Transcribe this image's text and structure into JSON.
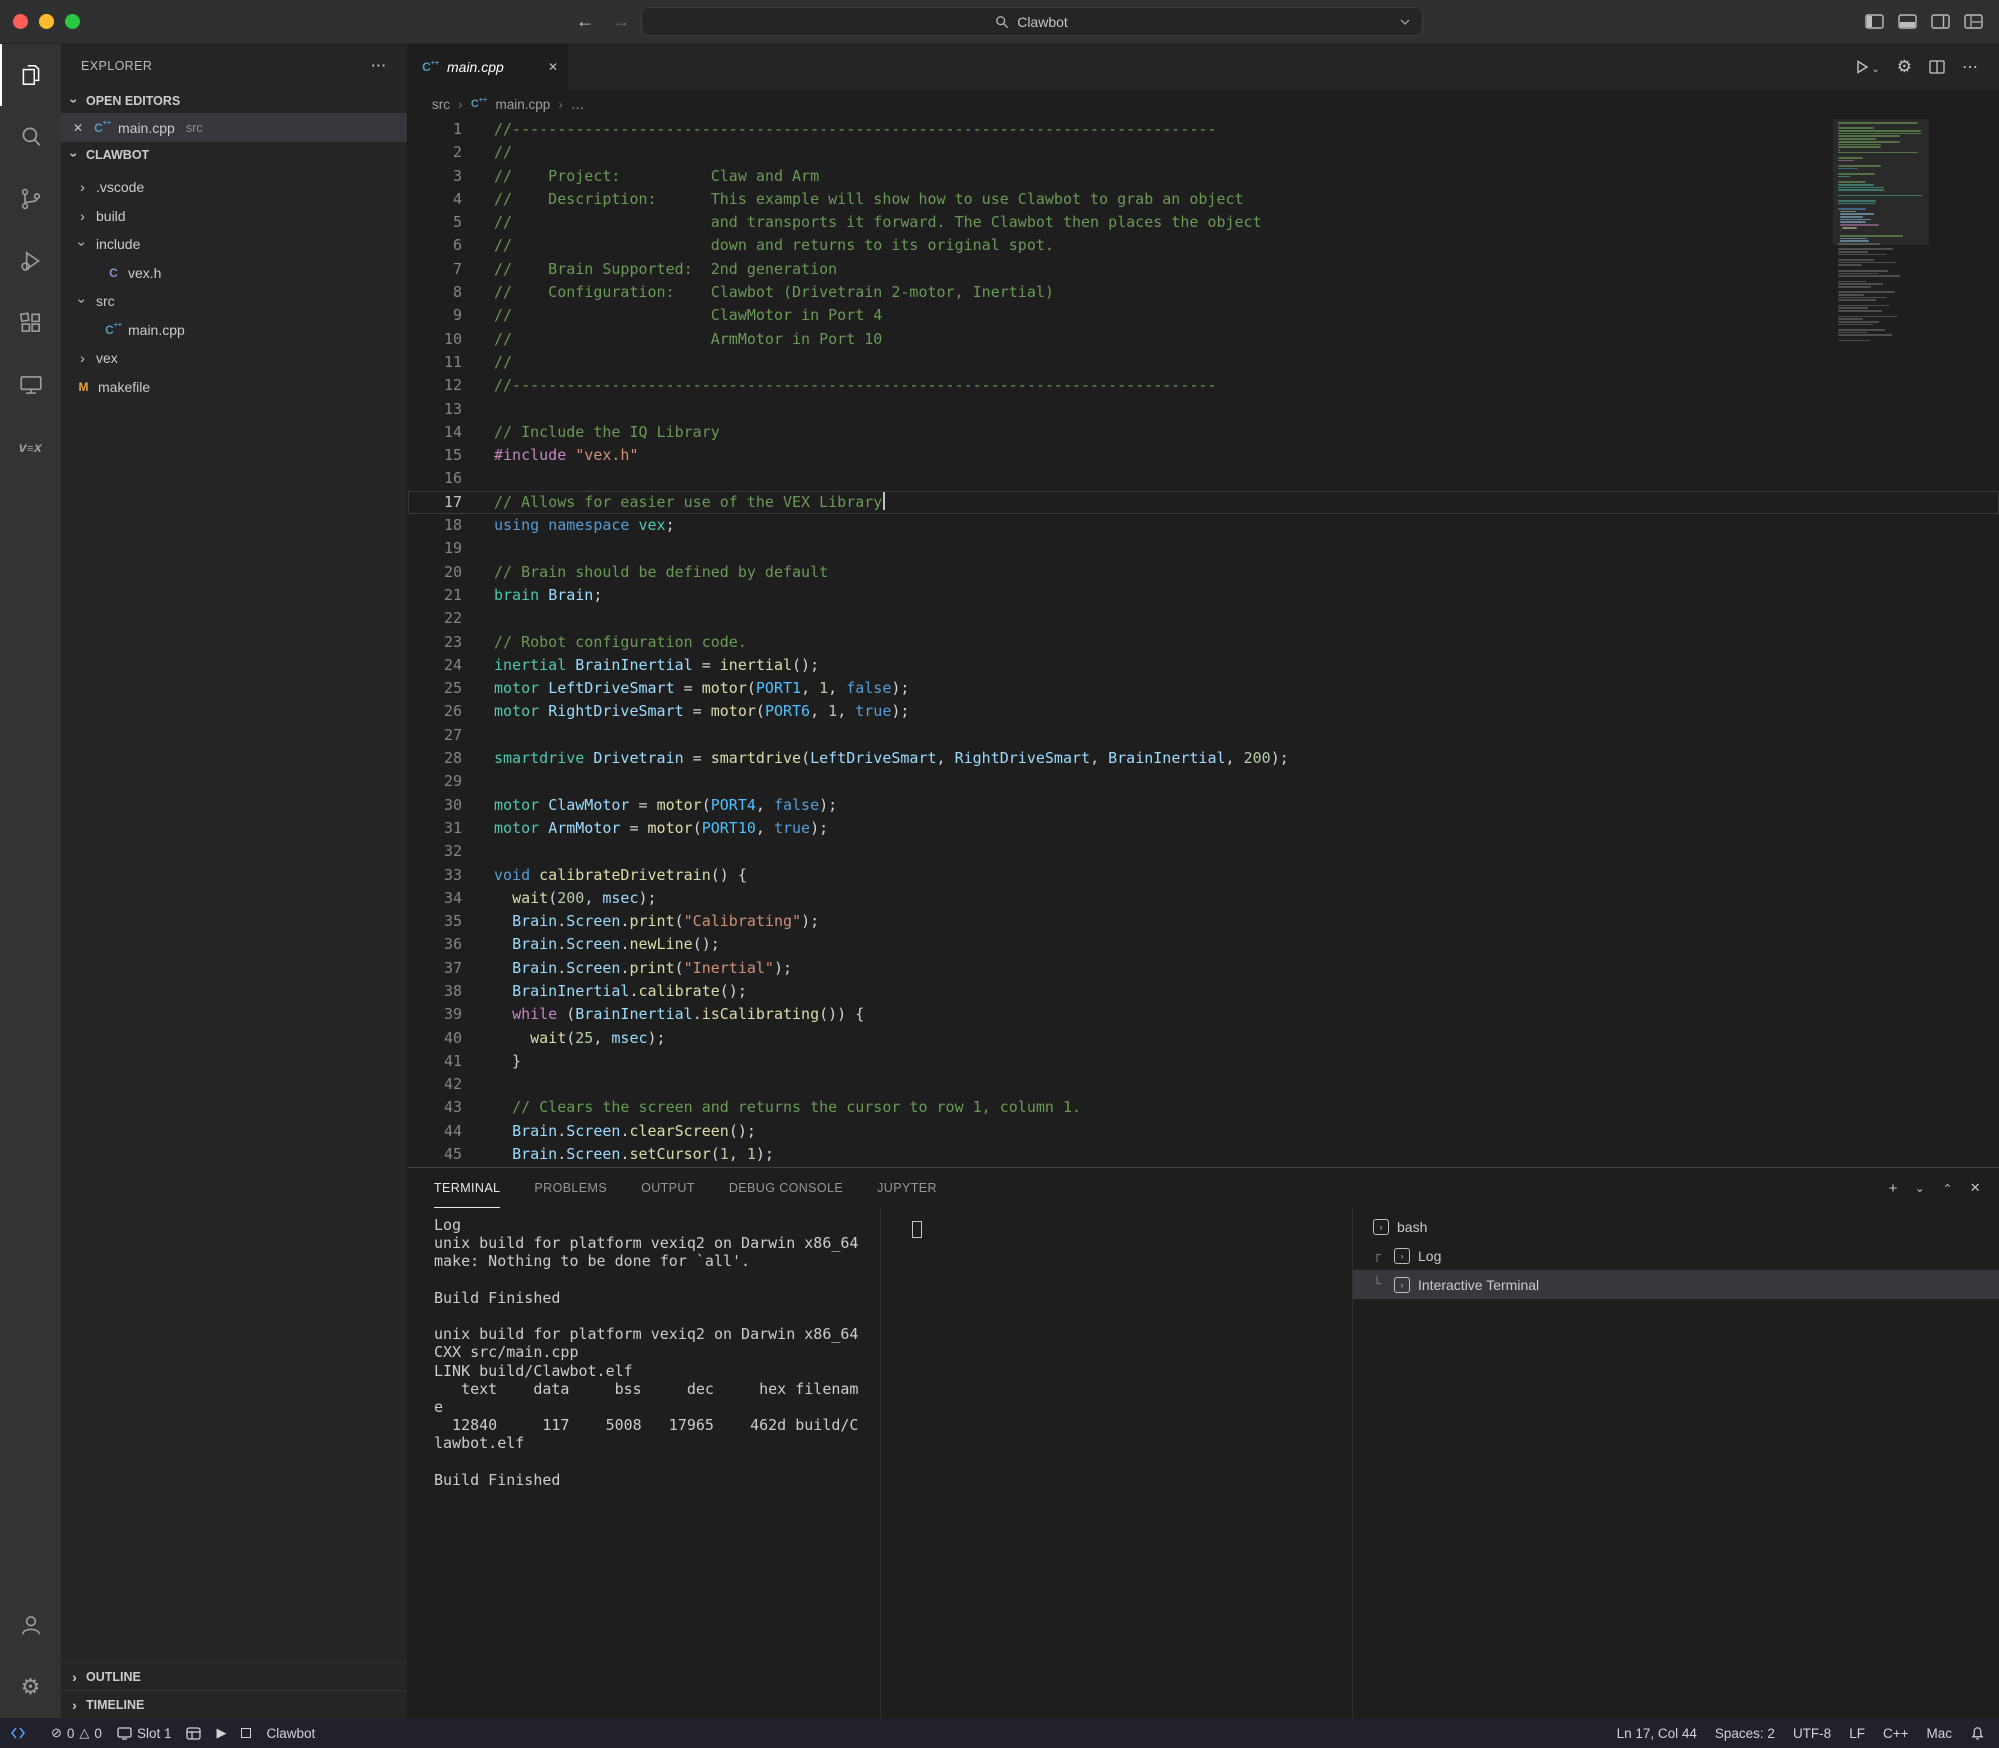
{
  "titlebar": {
    "search_text": "Clawbot",
    "traffic_lights": [
      "close",
      "minimize",
      "zoom"
    ],
    "nav_icons": [
      "back-arrow",
      "forward-arrow"
    ],
    "window_icons": [
      "toggle-primary-sidebar",
      "toggle-panel",
      "toggle-secondary-sidebar",
      "customize-layout"
    ]
  },
  "activity_bar": {
    "items": [
      {
        "name": "explorer",
        "active": true
      },
      {
        "name": "search",
        "active": false
      },
      {
        "name": "source-control",
        "active": false
      },
      {
        "name": "run-debug",
        "active": false
      },
      {
        "name": "extensions",
        "active": false
      },
      {
        "name": "remote-explorer",
        "active": false
      },
      {
        "name": "vex",
        "active": false,
        "label": "vex"
      }
    ],
    "bottom": [
      "account",
      "settings-gear"
    ]
  },
  "sidebar": {
    "title": "EXPLORER",
    "more_label": "···",
    "open_editors": {
      "label": "OPEN EDITORS",
      "items": [
        {
          "file": "main.cpp",
          "detail": "src",
          "icon": "cpp"
        }
      ]
    },
    "project": {
      "label": "CLAWBOT",
      "tree": [
        {
          "label": ".vscode",
          "kind": "folder",
          "state": "collapsed",
          "depth": 0
        },
        {
          "label": "build",
          "kind": "folder",
          "state": "collapsed",
          "depth": 0
        },
        {
          "label": "include",
          "kind": "folder",
          "state": "expanded",
          "depth": 0
        },
        {
          "label": "vex.h",
          "kind": "file",
          "icon": "c",
          "depth": 1
        },
        {
          "label": "src",
          "kind": "folder",
          "state": "expanded",
          "depth": 0
        },
        {
          "label": "main.cpp",
          "kind": "file",
          "icon": "cpp",
          "depth": 1
        },
        {
          "label": "vex",
          "kind": "folder",
          "state": "collapsed",
          "depth": 0
        },
        {
          "label": "makefile",
          "kind": "file",
          "icon": "makefile",
          "depth": 0
        }
      ]
    },
    "bottom_sections": [
      {
        "label": "OUTLINE"
      },
      {
        "label": "TIMELINE"
      }
    ]
  },
  "editor": {
    "tab": {
      "label": "main.cpp",
      "icon": "cpp"
    },
    "actions": [
      "run",
      "settings-gear",
      "split-editor",
      "more-actions"
    ],
    "breadcrumbs": [
      "src",
      "main.cpp",
      "…"
    ],
    "cursor_line": 17,
    "lines": [
      [
        [
          "//------------------------------------------------------------------------------",
          "c"
        ]
      ],
      [
        [
          "//",
          "c"
        ]
      ],
      [
        [
          "//    Project:          Claw and Arm",
          "c"
        ]
      ],
      [
        [
          "//    Description:      This example will show how to use Clawbot to grab an object",
          "c"
        ]
      ],
      [
        [
          "//                      and transports it forward. The Clawbot then places the object",
          "c"
        ]
      ],
      [
        [
          "//                      down and returns to its original spot.",
          "c"
        ]
      ],
      [
        [
          "//    Brain Supported:  2nd generation",
          "c"
        ]
      ],
      [
        [
          "//    Configuration:    Clawbot (Drivetrain 2-motor, Inertial)",
          "c"
        ]
      ],
      [
        [
          "//                      ClawMotor in Port 4",
          "c"
        ]
      ],
      [
        [
          "//                      ArmMotor in Port 10",
          "c"
        ]
      ],
      [
        [
          "//",
          "c"
        ]
      ],
      [
        [
          "//------------------------------------------------------------------------------",
          "c"
        ]
      ],
      [],
      [
        [
          "// Include the IQ Library",
          "c"
        ]
      ],
      [
        [
          "#include",
          "m"
        ],
        [
          " ",
          ""
        ],
        [
          "\"vex.h\"",
          "s"
        ]
      ],
      [],
      [
        [
          "// Allows for easier use of the VEX Library",
          "c"
        ]
      ],
      [
        [
          "using",
          "k"
        ],
        [
          " ",
          ""
        ],
        [
          "namespace",
          "k"
        ],
        [
          " ",
          ""
        ],
        [
          "vex",
          "t"
        ],
        [
          ";",
          ""
        ]
      ],
      [],
      [
        [
          "// Brain should be defined by default",
          "c"
        ]
      ],
      [
        [
          "brain",
          "t"
        ],
        [
          " ",
          ""
        ],
        [
          "Brain",
          "v"
        ],
        [
          ";",
          ""
        ]
      ],
      [],
      [
        [
          "// Robot configuration code.",
          "c"
        ]
      ],
      [
        [
          "inertial",
          "t"
        ],
        [
          " ",
          ""
        ],
        [
          "BrainInertial",
          "v"
        ],
        [
          " = ",
          ""
        ],
        [
          "inertial",
          "f"
        ],
        [
          "();",
          ""
        ]
      ],
      [
        [
          "motor",
          "t"
        ],
        [
          " ",
          ""
        ],
        [
          "LeftDriveSmart",
          "v"
        ],
        [
          " = ",
          ""
        ],
        [
          "motor",
          "f"
        ],
        [
          "(",
          ""
        ],
        [
          "PORT1",
          "e"
        ],
        [
          ", ",
          ""
        ],
        [
          "1",
          "n"
        ],
        [
          ", ",
          ""
        ],
        [
          "false",
          "k"
        ],
        [
          ");",
          ""
        ]
      ],
      [
        [
          "motor",
          "t"
        ],
        [
          " ",
          ""
        ],
        [
          "RightDriveSmart",
          "v"
        ],
        [
          " = ",
          ""
        ],
        [
          "motor",
          "f"
        ],
        [
          "(",
          ""
        ],
        [
          "PORT6",
          "e"
        ],
        [
          ", ",
          ""
        ],
        [
          "1",
          "n"
        ],
        [
          ", ",
          ""
        ],
        [
          "true",
          "k"
        ],
        [
          ");",
          ""
        ]
      ],
      [],
      [
        [
          "smartdrive",
          "t"
        ],
        [
          " ",
          ""
        ],
        [
          "Drivetrain",
          "v"
        ],
        [
          " = ",
          ""
        ],
        [
          "smartdrive",
          "f"
        ],
        [
          "(",
          ""
        ],
        [
          "LeftDriveSmart",
          "v"
        ],
        [
          ", ",
          ""
        ],
        [
          "RightDriveSmart",
          "v"
        ],
        [
          ", ",
          ""
        ],
        [
          "BrainInertial",
          "v"
        ],
        [
          ", ",
          ""
        ],
        [
          "200",
          "n"
        ],
        [
          ");",
          ""
        ]
      ],
      [],
      [
        [
          "motor",
          "t"
        ],
        [
          " ",
          ""
        ],
        [
          "ClawMotor",
          "v"
        ],
        [
          " = ",
          ""
        ],
        [
          "motor",
          "f"
        ],
        [
          "(",
          ""
        ],
        [
          "PORT4",
          "e"
        ],
        [
          ", ",
          ""
        ],
        [
          "false",
          "k"
        ],
        [
          ");",
          ""
        ]
      ],
      [
        [
          "motor",
          "t"
        ],
        [
          " ",
          ""
        ],
        [
          "ArmMotor",
          "v"
        ],
        [
          " = ",
          ""
        ],
        [
          "motor",
          "f"
        ],
        [
          "(",
          ""
        ],
        [
          "PORT10",
          "e"
        ],
        [
          ", ",
          ""
        ],
        [
          "true",
          "k"
        ],
        [
          ");",
          ""
        ]
      ],
      [],
      [
        [
          "void",
          "k"
        ],
        [
          " ",
          ""
        ],
        [
          "calibrateDrivetrain",
          "f"
        ],
        [
          "() {",
          ""
        ]
      ],
      [
        [
          "  ",
          ""
        ],
        [
          "wait",
          "f"
        ],
        [
          "(",
          ""
        ],
        [
          "200",
          "n"
        ],
        [
          ", ",
          ""
        ],
        [
          "msec",
          "v"
        ],
        [
          ");",
          ""
        ]
      ],
      [
        [
          "  ",
          ""
        ],
        [
          "Brain",
          "v"
        ],
        [
          ".",
          ""
        ],
        [
          "Screen",
          "v"
        ],
        [
          ".",
          ""
        ],
        [
          "print",
          "f"
        ],
        [
          "(",
          ""
        ],
        [
          "\"Calibrating\"",
          "s"
        ],
        [
          ");",
          ""
        ]
      ],
      [
        [
          "  ",
          ""
        ],
        [
          "Brain",
          "v"
        ],
        [
          ".",
          ""
        ],
        [
          "Screen",
          "v"
        ],
        [
          ".",
          ""
        ],
        [
          "newLine",
          "f"
        ],
        [
          "();",
          ""
        ]
      ],
      [
        [
          "  ",
          ""
        ],
        [
          "Brain",
          "v"
        ],
        [
          ".",
          ""
        ],
        [
          "Screen",
          "v"
        ],
        [
          ".",
          ""
        ],
        [
          "print",
          "f"
        ],
        [
          "(",
          ""
        ],
        [
          "\"Inertial\"",
          "s"
        ],
        [
          ");",
          ""
        ]
      ],
      [
        [
          "  ",
          ""
        ],
        [
          "BrainInertial",
          "v"
        ],
        [
          ".",
          ""
        ],
        [
          "calibrate",
          "f"
        ],
        [
          "();",
          ""
        ]
      ],
      [
        [
          "  ",
          ""
        ],
        [
          "while",
          "m"
        ],
        [
          " (",
          ""
        ],
        [
          "BrainInertial",
          "v"
        ],
        [
          ".",
          ""
        ],
        [
          "isCalibrating",
          "f"
        ],
        [
          "()) {",
          ""
        ]
      ],
      [
        [
          "    ",
          ""
        ],
        [
          "wait",
          "f"
        ],
        [
          "(",
          ""
        ],
        [
          "25",
          "n"
        ],
        [
          ", ",
          ""
        ],
        [
          "msec",
          "v"
        ],
        [
          ");",
          ""
        ]
      ],
      [
        [
          "  }",
          ""
        ]
      ],
      [],
      [
        [
          "  ",
          ""
        ],
        [
          "// Clears the screen and returns the cursor to row 1, column 1.",
          "c"
        ]
      ],
      [
        [
          "  ",
          ""
        ],
        [
          "Brain",
          "v"
        ],
        [
          ".",
          ""
        ],
        [
          "Screen",
          "v"
        ],
        [
          ".",
          ""
        ],
        [
          "clearScreen",
          "f"
        ],
        [
          "();",
          ""
        ]
      ],
      [
        [
          "  ",
          ""
        ],
        [
          "Brain",
          "v"
        ],
        [
          ".",
          ""
        ],
        [
          "Screen",
          "v"
        ],
        [
          ".",
          ""
        ],
        [
          "setCursor",
          "f"
        ],
        [
          "(",
          ""
        ],
        [
          "1",
          "n"
        ],
        [
          ", ",
          ""
        ],
        [
          "1",
          "n"
        ],
        [
          ");",
          ""
        ]
      ]
    ]
  },
  "panel": {
    "tabs": [
      {
        "label": "TERMINAL",
        "active": true
      },
      {
        "label": "PROBLEMS",
        "active": false
      },
      {
        "label": "OUTPUT",
        "active": false
      },
      {
        "label": "DEBUG CONSOLE",
        "active": false
      },
      {
        "label": "JUPYTER",
        "active": false
      }
    ],
    "action_icons": [
      "new-terminal",
      "terminal-dropdown",
      "maximize-panel",
      "close-panel"
    ],
    "terminal_output": [
      "Log",
      "unix build for platform vexiq2 on Darwin x86_64",
      "make: Nothing to be done for `all'.",
      "",
      "Build Finished",
      "",
      "unix build for platform vexiq2 on Darwin x86_64",
      "CXX src/main.cpp",
      "LINK build/Clawbot.elf",
      "   text    data     bss     dec     hex filenam",
      "e",
      "  12840     117    5008   17965    462d build/C",
      "lawbot.elf",
      "",
      "Build Finished"
    ],
    "terminal_list": [
      {
        "label": "bash",
        "depth": 0,
        "connector": "",
        "selected": false
      },
      {
        "label": "Log",
        "depth": 1,
        "connector": "┌",
        "selected": false
      },
      {
        "label": "Interactive Terminal",
        "depth": 1,
        "connector": "└",
        "selected": true
      }
    ]
  },
  "status_bar": {
    "left": {
      "errors": "0",
      "warnings": "0",
      "slot": "Slot 1",
      "program": "Clawbot",
      "icons": [
        "remote-window",
        "error-circle",
        "warning-triangle",
        "slot-screen",
        "vex-brain",
        "play",
        "stop"
      ]
    },
    "right": [
      "Ln 17, Col 44",
      "Spaces: 2",
      "UTF-8",
      "LF",
      "C++",
      "Mac"
    ],
    "right_icons": [
      "bell"
    ]
  }
}
